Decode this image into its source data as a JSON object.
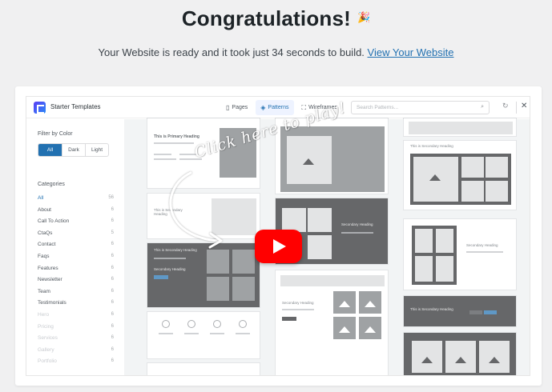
{
  "headline": {
    "title": "Congratulations!",
    "emoji": "🎉"
  },
  "subline": {
    "text": "Your Website is ready and it took just 34 seconds to build.",
    "link": "View Your Website"
  },
  "video": {
    "app": {
      "brand": "Starter Templates"
    },
    "tabs": [
      {
        "label": "Pages",
        "icon": "page-icon"
      },
      {
        "label": "Patterns",
        "icon": "pattern-icon",
        "active": true
      },
      {
        "label": "Wireframes",
        "icon": "wireframe-icon"
      }
    ],
    "search": {
      "placeholder": "Search Patterns..."
    },
    "sidebar": {
      "filter_title": "Filter by Color",
      "filters": [
        "All",
        "Dark",
        "Light"
      ],
      "categories_title": "Categories",
      "categories": [
        {
          "label": "All",
          "count": "56"
        },
        {
          "label": "About",
          "count": "6"
        },
        {
          "label": "Call To Action",
          "count": "6"
        },
        {
          "label": "CtaQs",
          "count": "5"
        },
        {
          "label": "Contact",
          "count": "6"
        },
        {
          "label": "Faqs",
          "count": "6"
        },
        {
          "label": "Features",
          "count": "6"
        },
        {
          "label": "Newsletter",
          "count": "6"
        },
        {
          "label": "Team",
          "count": "6"
        },
        {
          "label": "Testimonials",
          "count": "6"
        },
        {
          "label": "Hero",
          "count": "6"
        },
        {
          "label": "Pricing",
          "count": "6"
        },
        {
          "label": "Services",
          "count": "6"
        },
        {
          "label": "Gallery",
          "count": "6"
        },
        {
          "label": "Portfolio",
          "count": "6"
        }
      ]
    },
    "tiles": {
      "primary_heading": "This is Primary Heading",
      "secondary_heading": "This is Secondary Heading",
      "secondary_heading_2": "Secondary Heading"
    },
    "overlay_text": "Click here to play!",
    "play_icon": "youtube-play-icon"
  }
}
